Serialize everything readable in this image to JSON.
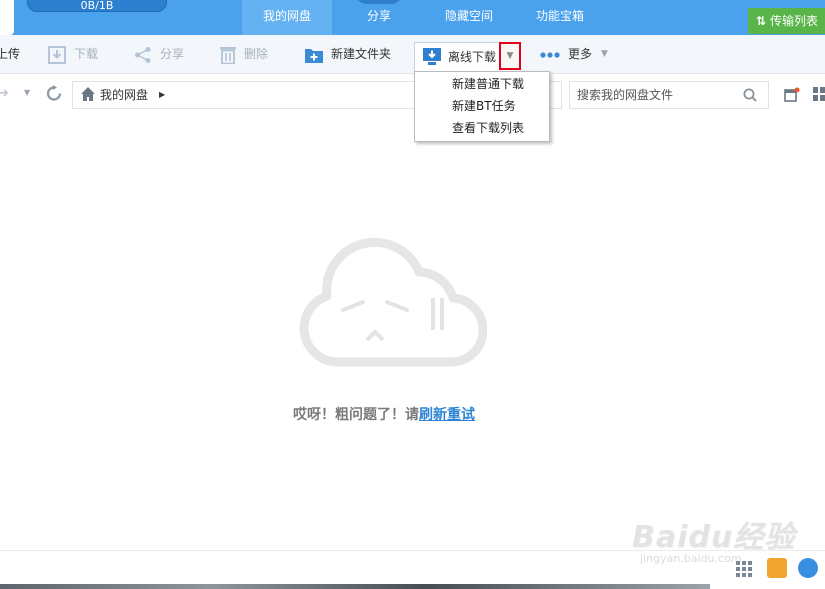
{
  "header": {
    "quota": "0B/1B",
    "nav": [
      "我的网盘",
      "分享",
      "隐藏空间",
      "功能宝箱"
    ],
    "transfer_label": "传输列表"
  },
  "toolbar": {
    "upload": "上传",
    "download": "下载",
    "share": "分享",
    "delete": "删除",
    "new_folder": "新建文件夹",
    "offline_download": "离线下载",
    "more": "更多"
  },
  "dropdown": {
    "items": [
      "新建普通下载",
      "新建BT任务",
      "查看下载列表"
    ]
  },
  "address": {
    "breadcrumb": "我的网盘",
    "search_placeholder": "搜索我的网盘文件"
  },
  "empty": {
    "message": "哎呀！粗问题了！请",
    "link": "刷新重试"
  },
  "watermark": {
    "title": "Baidu经验",
    "url": "jingyan.baidu.com"
  },
  "colors": {
    "topbar": "#4aa1ec",
    "active_tab": "#65b2f2",
    "transfer_button": "#59b44a",
    "highlight_box": "#e2001a",
    "link": "#2e85d6"
  }
}
